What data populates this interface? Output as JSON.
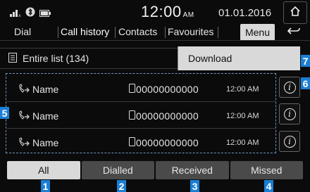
{
  "status_bar": {
    "icons": [
      "signal-bars-icon",
      "bluetooth-icon",
      "battery-icon"
    ],
    "time": "12:00",
    "time_suffix": "AM",
    "date": "01.01.2016",
    "home_icon": "home-icon"
  },
  "tabs": [
    {
      "label": "Dial",
      "active": false
    },
    {
      "label": "Call history",
      "active": true
    },
    {
      "label": "Contacts",
      "active": false
    },
    {
      "label": "Favourites",
      "active": false
    }
  ],
  "menu_label": "Menu",
  "back_icon": "back-arrow-icon",
  "entire_list": {
    "icon": "list-icon",
    "label": "Entire list (134)"
  },
  "download_label": "Download",
  "calls": [
    {
      "name": "Name",
      "number": "00000000000",
      "time": "12:00 AM",
      "call_icon": "outgoing-call-icon",
      "phone_icon": "phone-device-icon",
      "info_icon": "info-icon"
    },
    {
      "name": "Name",
      "number": "00000000000",
      "time": "12:00 AM",
      "call_icon": "outgoing-call-icon",
      "phone_icon": "phone-device-icon",
      "info_icon": "info-icon"
    },
    {
      "name": "Name",
      "number": "00000000000",
      "time": "12:00 AM",
      "call_icon": "outgoing-call-icon",
      "phone_icon": "phone-device-icon",
      "info_icon": "info-icon"
    }
  ],
  "filters": [
    {
      "label": "All",
      "active": true
    },
    {
      "label": "Dialled",
      "active": false
    },
    {
      "label": "Received",
      "active": false
    },
    {
      "label": "Missed",
      "active": false
    }
  ],
  "callouts": {
    "filter_all": "1",
    "filter_dialled": "2",
    "filter_received": "3",
    "filter_missed": "4",
    "call_list": "5",
    "info_buttons": "6",
    "download": "7"
  },
  "colors": {
    "callout": "#1a7fd6",
    "selected_button": "#d9d9d9",
    "filter_button": "#4a4a4a",
    "list_outline": "#6f98c4"
  }
}
